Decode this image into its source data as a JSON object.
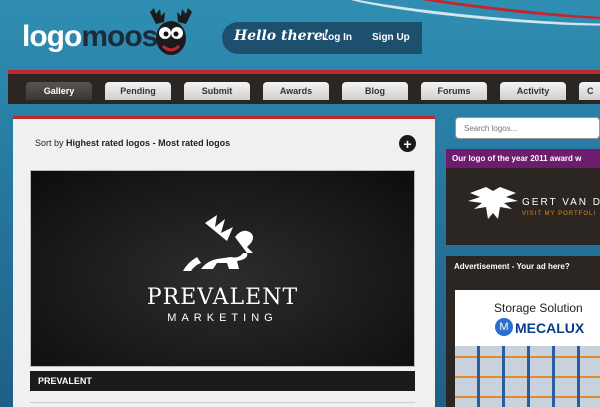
{
  "header": {
    "logo_part1": "logo",
    "logo_part2": "moose",
    "greeting": "Hello there!",
    "login_label": "Log In",
    "signup_label": "Sign Up"
  },
  "tabs": [
    "Gallery",
    "Pending",
    "Submit",
    "Awards",
    "Blog",
    "Forums",
    "Activity",
    "C"
  ],
  "main": {
    "sort_prefix": "Sort by",
    "sort_highest": "Highest rated logos",
    "sort_separator": "-",
    "sort_most": "Most rated logos",
    "add_symbol": "+",
    "featured_logo": {
      "name_line1": "PREVALENT",
      "name_line2": "MARKETING",
      "caption": "PREVALENT"
    }
  },
  "sidebar": {
    "search_placeholder": "Search logos...",
    "award_header": "Our logo of the year 2011 award w",
    "award_name": "GERT VAN DU",
    "award_link": "VISIT MY PORTFOLI",
    "ad_header": "Advertisement - Your ad here?",
    "ad_title": "Storage Solution",
    "ad_brand": "MECALUX",
    "ad_brand_mark": "M"
  },
  "colors": {
    "accent_red": "#c0282f",
    "award_purple": "#6e1d6e",
    "dark_bar": "#2b2622",
    "background_blue": "#2678a0"
  }
}
